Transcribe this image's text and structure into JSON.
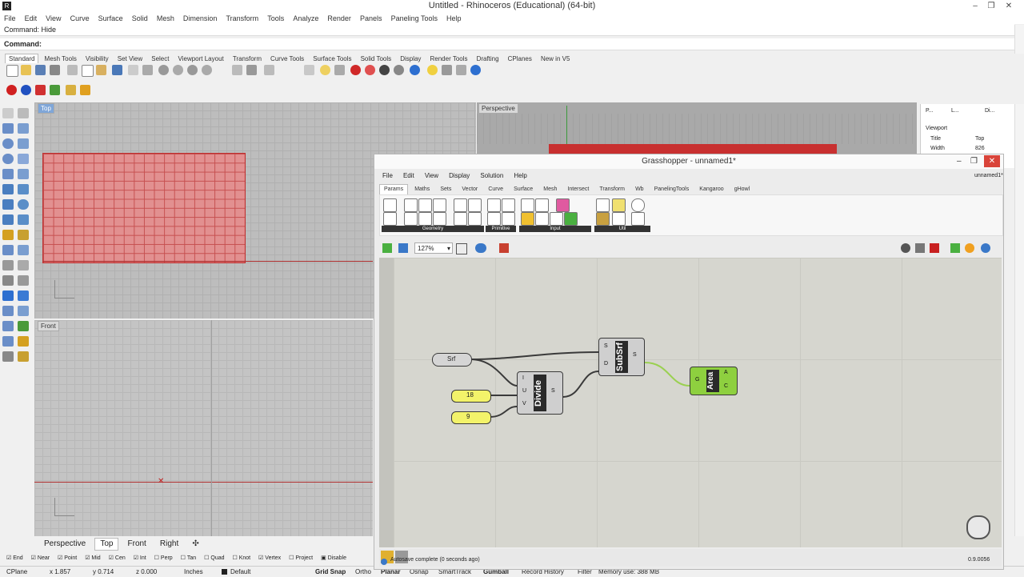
{
  "window": {
    "title": "Untitled - Rhinoceros (Educational) (64-bit)"
  },
  "menu": [
    "File",
    "Edit",
    "View",
    "Curve",
    "Surface",
    "Solid",
    "Mesh",
    "Dimension",
    "Transform",
    "Tools",
    "Analyze",
    "Render",
    "Panels",
    "Paneling Tools",
    "Help"
  ],
  "command": {
    "history": "Command: Hide",
    "prompt": "Command:"
  },
  "toolbar_tabs": [
    "Standard",
    "Mesh Tools",
    "Visibility",
    "Set View",
    "Select",
    "Viewport Layout",
    "Transform",
    "Curve Tools",
    "Surface Tools",
    "Solid Tools",
    "Display",
    "Render Tools",
    "Drafting",
    "CPlanes",
    "New in V5"
  ],
  "viewports": {
    "top": "Top",
    "front": "Front",
    "perspective": "Perspective"
  },
  "viewport_tabs": [
    "Perspective",
    "Top",
    "Front",
    "Right"
  ],
  "properties": {
    "tab1": "P...",
    "tab2": "L...",
    "tab3": "Di...",
    "section": "Viewport",
    "title_label": "Title",
    "title_value": "Top",
    "width_label": "Width",
    "width_value": "826"
  },
  "osnaps": [
    "End",
    "Near",
    "Point",
    "Mid",
    "Cen",
    "Int",
    "Perp",
    "Tan",
    "Quad",
    "Knot",
    "Vertex",
    "Project",
    "Disable"
  ],
  "status": {
    "cplane": "CPlane",
    "x": "x 1.857",
    "y": "y 0.714",
    "z": "z 0.000",
    "units": "Inches",
    "layer": "Default",
    "grid_snap": "Grid Snap",
    "ortho": "Ortho",
    "planar": "Planar",
    "osnap": "Osnap",
    "smarttrack": "SmartTrack",
    "gumball": "Gumball",
    "record_history": "Record History",
    "filter": "Filter",
    "memory": "Memory use: 388 MB"
  },
  "grasshopper": {
    "title": "Grasshopper - unnamed1*",
    "doc_tab": "unnamed1*",
    "menu": [
      "File",
      "Edit",
      "View",
      "Display",
      "Solution",
      "Help"
    ],
    "tabs": [
      "Params",
      "Maths",
      "Sets",
      "Vector",
      "Curve",
      "Surface",
      "Mesh",
      "Intersect",
      "Transform",
      "Wb",
      "PanelingTools",
      "Kangaroo",
      "gHowl"
    ],
    "groups": [
      "Geometry",
      "Primitive",
      "Input",
      "Util"
    ],
    "zoom": "127%",
    "status": "Autosave complete (0 seconds ago)",
    "version": "0.9.0056",
    "nodes": {
      "srf": "Srf",
      "slider_u": "18",
      "slider_v": "9",
      "divide": {
        "name": "Divide",
        "in": [
          "I",
          "U",
          "V"
        ],
        "out": "S"
      },
      "subsrf": {
        "name": "SubSrf",
        "in": [
          "S",
          "D"
        ],
        "out": "S"
      },
      "area": {
        "name": "Area",
        "in": "G",
        "out": [
          "A",
          "C"
        ]
      }
    }
  }
}
